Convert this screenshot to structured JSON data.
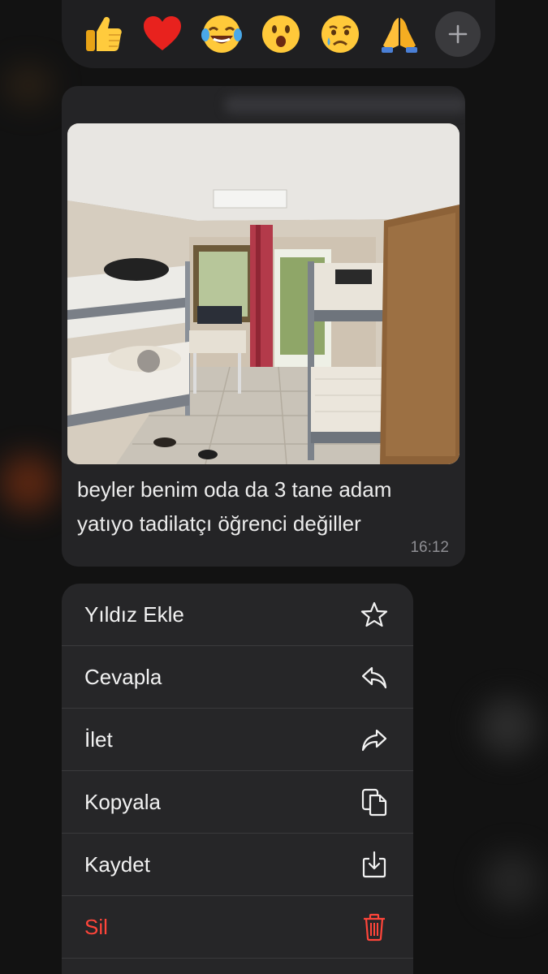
{
  "reactions": {
    "emojis": [
      {
        "name": "thumbs-up",
        "glyph": "👍"
      },
      {
        "name": "red-heart",
        "glyph": "❤️"
      },
      {
        "name": "tears-of-joy",
        "glyph": "😂"
      },
      {
        "name": "surprised",
        "glyph": "😮"
      },
      {
        "name": "crying",
        "glyph": "😢"
      },
      {
        "name": "folded-hands",
        "glyph": "🙏"
      }
    ],
    "more_icon": "plus-icon"
  },
  "message": {
    "text": "beyler benim oda da 3 tane adam yatıyo tadilatçı öğrenci değiller",
    "time": "16:12",
    "image": "photo of dorm room with bunk beds"
  },
  "menu": {
    "items": [
      {
        "label": "Yıldız Ekle",
        "icon": "star-icon"
      },
      {
        "label": "Cevapla",
        "icon": "reply-icon"
      },
      {
        "label": "İlet",
        "icon": "forward-icon"
      },
      {
        "label": "Kopyala",
        "icon": "copy-icon"
      },
      {
        "label": "Kaydet",
        "icon": "save-icon"
      },
      {
        "label": "Sil",
        "icon": "trash-icon"
      }
    ]
  },
  "colors": {
    "background": "#121212",
    "bubble": "#242426",
    "menu": "#262628",
    "danger": "#ff453a"
  }
}
